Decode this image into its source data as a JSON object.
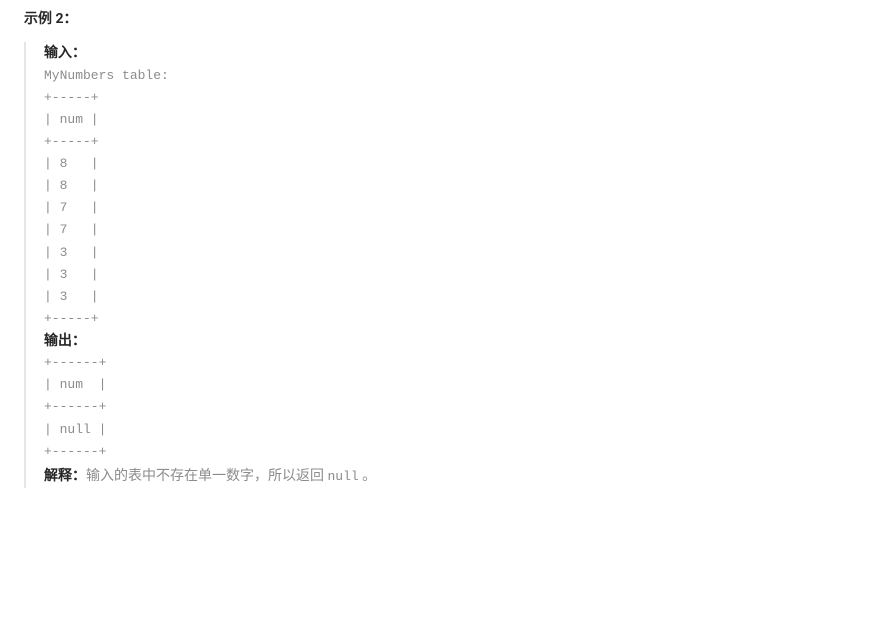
{
  "example_heading": "示例 2：",
  "input_label": "输入：",
  "input_code": "MyNumbers table:\n+-----+\n| num |\n+-----+\n| 8   |\n| 8   |\n| 7   |\n| 7   |\n| 3   |\n| 3   |\n| 3   |\n+-----+",
  "output_label": "输出：",
  "output_code": "+------+\n| num  |\n+------+\n| null |\n+------+",
  "explanation_label": "解释：",
  "explanation_text": "输入的表中不存在单一数字，所以返回 ",
  "explanation_code": "null",
  "explanation_suffix": " 。"
}
